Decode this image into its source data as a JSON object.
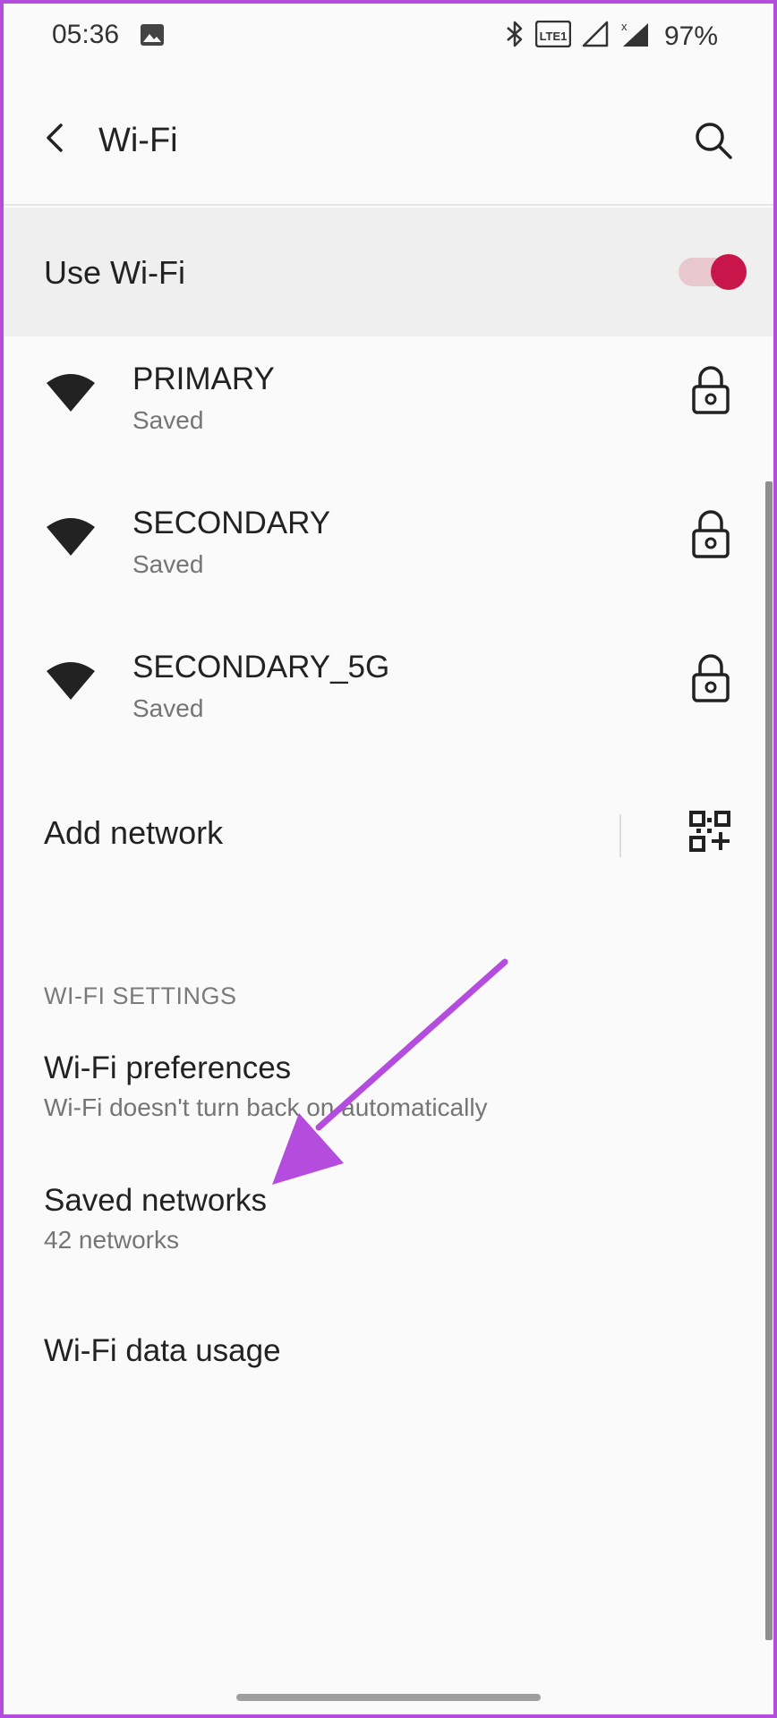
{
  "status_bar": {
    "time": "05:36",
    "battery": "97%",
    "icons": [
      "gallery-icon",
      "bluetooth-icon",
      "volte-icon",
      "signal-icon",
      "signal-x-icon"
    ],
    "volte_label": "LTE1"
  },
  "header": {
    "title": "Wi-Fi",
    "back_icon": "back-arrow-icon",
    "search_icon": "search-icon"
  },
  "use_wifi": {
    "label": "Use Wi-Fi",
    "enabled": true,
    "accent_color": "#c8164a"
  },
  "networks": [
    {
      "name": "PRIMARY",
      "status": "Saved",
      "secured": true
    },
    {
      "name": "SECONDARY",
      "status": "Saved",
      "secured": true
    },
    {
      "name": "SECONDARY_5G",
      "status": "Saved",
      "secured": true
    }
  ],
  "add_network": {
    "label": "Add network",
    "qr_icon": "qr-code-add-icon"
  },
  "wifi_settings": {
    "header": "WI-FI SETTINGS",
    "items": [
      {
        "title": "Wi-Fi preferences",
        "subtitle": "Wi-Fi doesn't turn back on automatically"
      },
      {
        "title": "Saved networks",
        "subtitle": "42 networks"
      },
      {
        "title": "Wi-Fi data usage",
        "subtitle": ""
      }
    ]
  },
  "annotation": {
    "color": "#b44dde",
    "icon": "pointer-arrow-icon"
  }
}
